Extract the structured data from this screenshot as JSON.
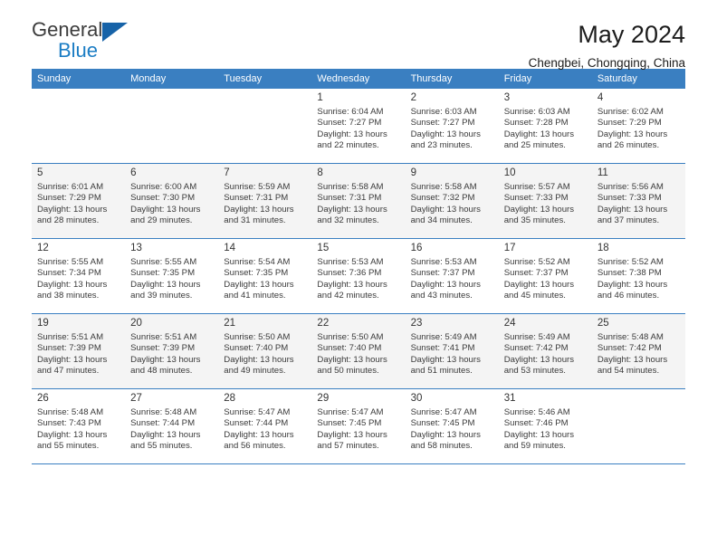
{
  "brand": {
    "name_top": "General",
    "name_bottom": "Blue",
    "color_dark": "#3c3c3c",
    "color_blue": "#1b7dc4"
  },
  "header": {
    "title": "May 2024",
    "location": "Chengbei, Chongqing, China"
  },
  "theme": {
    "header_blue": "#3a7fc1",
    "row_stripe": "#f4f4f4"
  },
  "weekdays": [
    "Sunday",
    "Monday",
    "Tuesday",
    "Wednesday",
    "Thursday",
    "Friday",
    "Saturday"
  ],
  "weeks": [
    [
      {
        "day": "",
        "sunrise": "",
        "sunset": "",
        "daylight1": "",
        "daylight2": "",
        "empty": true
      },
      {
        "day": "",
        "sunrise": "",
        "sunset": "",
        "daylight1": "",
        "daylight2": "",
        "empty": true
      },
      {
        "day": "",
        "sunrise": "",
        "sunset": "",
        "daylight1": "",
        "daylight2": "",
        "empty": true
      },
      {
        "day": "1",
        "sunrise": "Sunrise: 6:04 AM",
        "sunset": "Sunset: 7:27 PM",
        "daylight1": "Daylight: 13 hours",
        "daylight2": "and 22 minutes."
      },
      {
        "day": "2",
        "sunrise": "Sunrise: 6:03 AM",
        "sunset": "Sunset: 7:27 PM",
        "daylight1": "Daylight: 13 hours",
        "daylight2": "and 23 minutes."
      },
      {
        "day": "3",
        "sunrise": "Sunrise: 6:03 AM",
        "sunset": "Sunset: 7:28 PM",
        "daylight1": "Daylight: 13 hours",
        "daylight2": "and 25 minutes."
      },
      {
        "day": "4",
        "sunrise": "Sunrise: 6:02 AM",
        "sunset": "Sunset: 7:29 PM",
        "daylight1": "Daylight: 13 hours",
        "daylight2": "and 26 minutes."
      }
    ],
    [
      {
        "day": "5",
        "sunrise": "Sunrise: 6:01 AM",
        "sunset": "Sunset: 7:29 PM",
        "daylight1": "Daylight: 13 hours",
        "daylight2": "and 28 minutes."
      },
      {
        "day": "6",
        "sunrise": "Sunrise: 6:00 AM",
        "sunset": "Sunset: 7:30 PM",
        "daylight1": "Daylight: 13 hours",
        "daylight2": "and 29 minutes."
      },
      {
        "day": "7",
        "sunrise": "Sunrise: 5:59 AM",
        "sunset": "Sunset: 7:31 PM",
        "daylight1": "Daylight: 13 hours",
        "daylight2": "and 31 minutes."
      },
      {
        "day": "8",
        "sunrise": "Sunrise: 5:58 AM",
        "sunset": "Sunset: 7:31 PM",
        "daylight1": "Daylight: 13 hours",
        "daylight2": "and 32 minutes."
      },
      {
        "day": "9",
        "sunrise": "Sunrise: 5:58 AM",
        "sunset": "Sunset: 7:32 PM",
        "daylight1": "Daylight: 13 hours",
        "daylight2": "and 34 minutes."
      },
      {
        "day": "10",
        "sunrise": "Sunrise: 5:57 AM",
        "sunset": "Sunset: 7:33 PM",
        "daylight1": "Daylight: 13 hours",
        "daylight2": "and 35 minutes."
      },
      {
        "day": "11",
        "sunrise": "Sunrise: 5:56 AM",
        "sunset": "Sunset: 7:33 PM",
        "daylight1": "Daylight: 13 hours",
        "daylight2": "and 37 minutes."
      }
    ],
    [
      {
        "day": "12",
        "sunrise": "Sunrise: 5:55 AM",
        "sunset": "Sunset: 7:34 PM",
        "daylight1": "Daylight: 13 hours",
        "daylight2": "and 38 minutes."
      },
      {
        "day": "13",
        "sunrise": "Sunrise: 5:55 AM",
        "sunset": "Sunset: 7:35 PM",
        "daylight1": "Daylight: 13 hours",
        "daylight2": "and 39 minutes."
      },
      {
        "day": "14",
        "sunrise": "Sunrise: 5:54 AM",
        "sunset": "Sunset: 7:35 PM",
        "daylight1": "Daylight: 13 hours",
        "daylight2": "and 41 minutes."
      },
      {
        "day": "15",
        "sunrise": "Sunrise: 5:53 AM",
        "sunset": "Sunset: 7:36 PM",
        "daylight1": "Daylight: 13 hours",
        "daylight2": "and 42 minutes."
      },
      {
        "day": "16",
        "sunrise": "Sunrise: 5:53 AM",
        "sunset": "Sunset: 7:37 PM",
        "daylight1": "Daylight: 13 hours",
        "daylight2": "and 43 minutes."
      },
      {
        "day": "17",
        "sunrise": "Sunrise: 5:52 AM",
        "sunset": "Sunset: 7:37 PM",
        "daylight1": "Daylight: 13 hours",
        "daylight2": "and 45 minutes."
      },
      {
        "day": "18",
        "sunrise": "Sunrise: 5:52 AM",
        "sunset": "Sunset: 7:38 PM",
        "daylight1": "Daylight: 13 hours",
        "daylight2": "and 46 minutes."
      }
    ],
    [
      {
        "day": "19",
        "sunrise": "Sunrise: 5:51 AM",
        "sunset": "Sunset: 7:39 PM",
        "daylight1": "Daylight: 13 hours",
        "daylight2": "and 47 minutes."
      },
      {
        "day": "20",
        "sunrise": "Sunrise: 5:51 AM",
        "sunset": "Sunset: 7:39 PM",
        "daylight1": "Daylight: 13 hours",
        "daylight2": "and 48 minutes."
      },
      {
        "day": "21",
        "sunrise": "Sunrise: 5:50 AM",
        "sunset": "Sunset: 7:40 PM",
        "daylight1": "Daylight: 13 hours",
        "daylight2": "and 49 minutes."
      },
      {
        "day": "22",
        "sunrise": "Sunrise: 5:50 AM",
        "sunset": "Sunset: 7:40 PM",
        "daylight1": "Daylight: 13 hours",
        "daylight2": "and 50 minutes."
      },
      {
        "day": "23",
        "sunrise": "Sunrise: 5:49 AM",
        "sunset": "Sunset: 7:41 PM",
        "daylight1": "Daylight: 13 hours",
        "daylight2": "and 51 minutes."
      },
      {
        "day": "24",
        "sunrise": "Sunrise: 5:49 AM",
        "sunset": "Sunset: 7:42 PM",
        "daylight1": "Daylight: 13 hours",
        "daylight2": "and 53 minutes."
      },
      {
        "day": "25",
        "sunrise": "Sunrise: 5:48 AM",
        "sunset": "Sunset: 7:42 PM",
        "daylight1": "Daylight: 13 hours",
        "daylight2": "and 54 minutes."
      }
    ],
    [
      {
        "day": "26",
        "sunrise": "Sunrise: 5:48 AM",
        "sunset": "Sunset: 7:43 PM",
        "daylight1": "Daylight: 13 hours",
        "daylight2": "and 55 minutes."
      },
      {
        "day": "27",
        "sunrise": "Sunrise: 5:48 AM",
        "sunset": "Sunset: 7:44 PM",
        "daylight1": "Daylight: 13 hours",
        "daylight2": "and 55 minutes."
      },
      {
        "day": "28",
        "sunrise": "Sunrise: 5:47 AM",
        "sunset": "Sunset: 7:44 PM",
        "daylight1": "Daylight: 13 hours",
        "daylight2": "and 56 minutes."
      },
      {
        "day": "29",
        "sunrise": "Sunrise: 5:47 AM",
        "sunset": "Sunset: 7:45 PM",
        "daylight1": "Daylight: 13 hours",
        "daylight2": "and 57 minutes."
      },
      {
        "day": "30",
        "sunrise": "Sunrise: 5:47 AM",
        "sunset": "Sunset: 7:45 PM",
        "daylight1": "Daylight: 13 hours",
        "daylight2": "and 58 minutes."
      },
      {
        "day": "31",
        "sunrise": "Sunrise: 5:46 AM",
        "sunset": "Sunset: 7:46 PM",
        "daylight1": "Daylight: 13 hours",
        "daylight2": "and 59 minutes."
      },
      {
        "day": "",
        "sunrise": "",
        "sunset": "",
        "daylight1": "",
        "daylight2": "",
        "empty": true
      }
    ]
  ]
}
